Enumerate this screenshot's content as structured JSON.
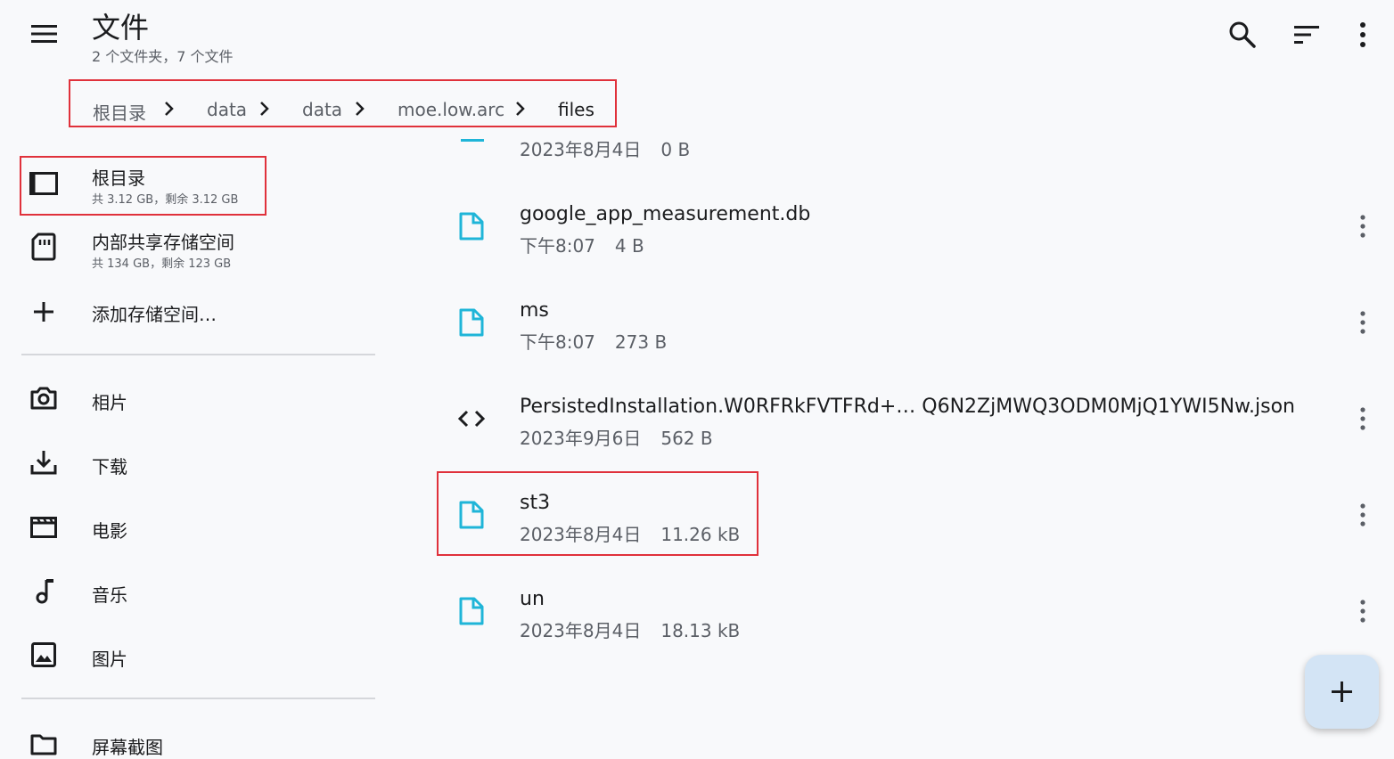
{
  "header": {
    "title": "文件",
    "subtitle": "2 个文件夹，7 个文件",
    "menu_icon": "menu-icon",
    "search_icon": "search-icon",
    "sort_icon": "sort-icon",
    "more_icon": "more-vert-icon"
  },
  "breadcrumb": [
    "根目录",
    "data",
    "data",
    "moe.low.arc",
    "files"
  ],
  "sidebar": {
    "storage": [
      {
        "label": "根目录",
        "sub": "共 3.12 GB，剩余 3.12 GB",
        "icon": "root-storage-icon"
      },
      {
        "label": "内部共享存储空间",
        "sub": "共 134 GB，剩余 123 GB",
        "icon": "sd-card-icon"
      },
      {
        "label": "添加存储空间…",
        "icon": "add-icon"
      }
    ],
    "bookmarks": [
      {
        "label": "相片",
        "icon": "camera-icon"
      },
      {
        "label": "下载",
        "icon": "download-icon"
      },
      {
        "label": "电影",
        "icon": "movie-icon"
      },
      {
        "label": "音乐",
        "icon": "music-note-icon"
      },
      {
        "label": "图片",
        "icon": "image-icon"
      }
    ],
    "folders": [
      {
        "label": "屏幕截图",
        "icon": "folder-icon"
      }
    ]
  },
  "files": {
    "partial": {
      "date": "2023年8月4日",
      "size": "0 B"
    },
    "items": [
      {
        "name": "google_app_measurement.db",
        "date": "下午8:07",
        "size": "4 B",
        "icon": "file-icon"
      },
      {
        "name": "ms",
        "date": "下午8:07",
        "size": "273 B",
        "icon": "file-icon"
      },
      {
        "name": "PersistedInstallation.W0RFRkFVTFRd+… Q6N2ZjMWQ3ODM0MjQ1YWI5Nw.json",
        "date": "2023年9月6日",
        "size": "562 B",
        "icon": "code-icon"
      },
      {
        "name": "st3",
        "date": "2023年8月4日",
        "size": "11.26 kB",
        "icon": "file-icon"
      },
      {
        "name": "un",
        "date": "2023年8月4日",
        "size": "18.13 kB",
        "icon": "file-icon"
      }
    ]
  },
  "fab_icon": "add-icon",
  "colors": {
    "accent": "#1fb5d8",
    "highlight": "#e0313b",
    "fab": "#d3e4f5"
  }
}
